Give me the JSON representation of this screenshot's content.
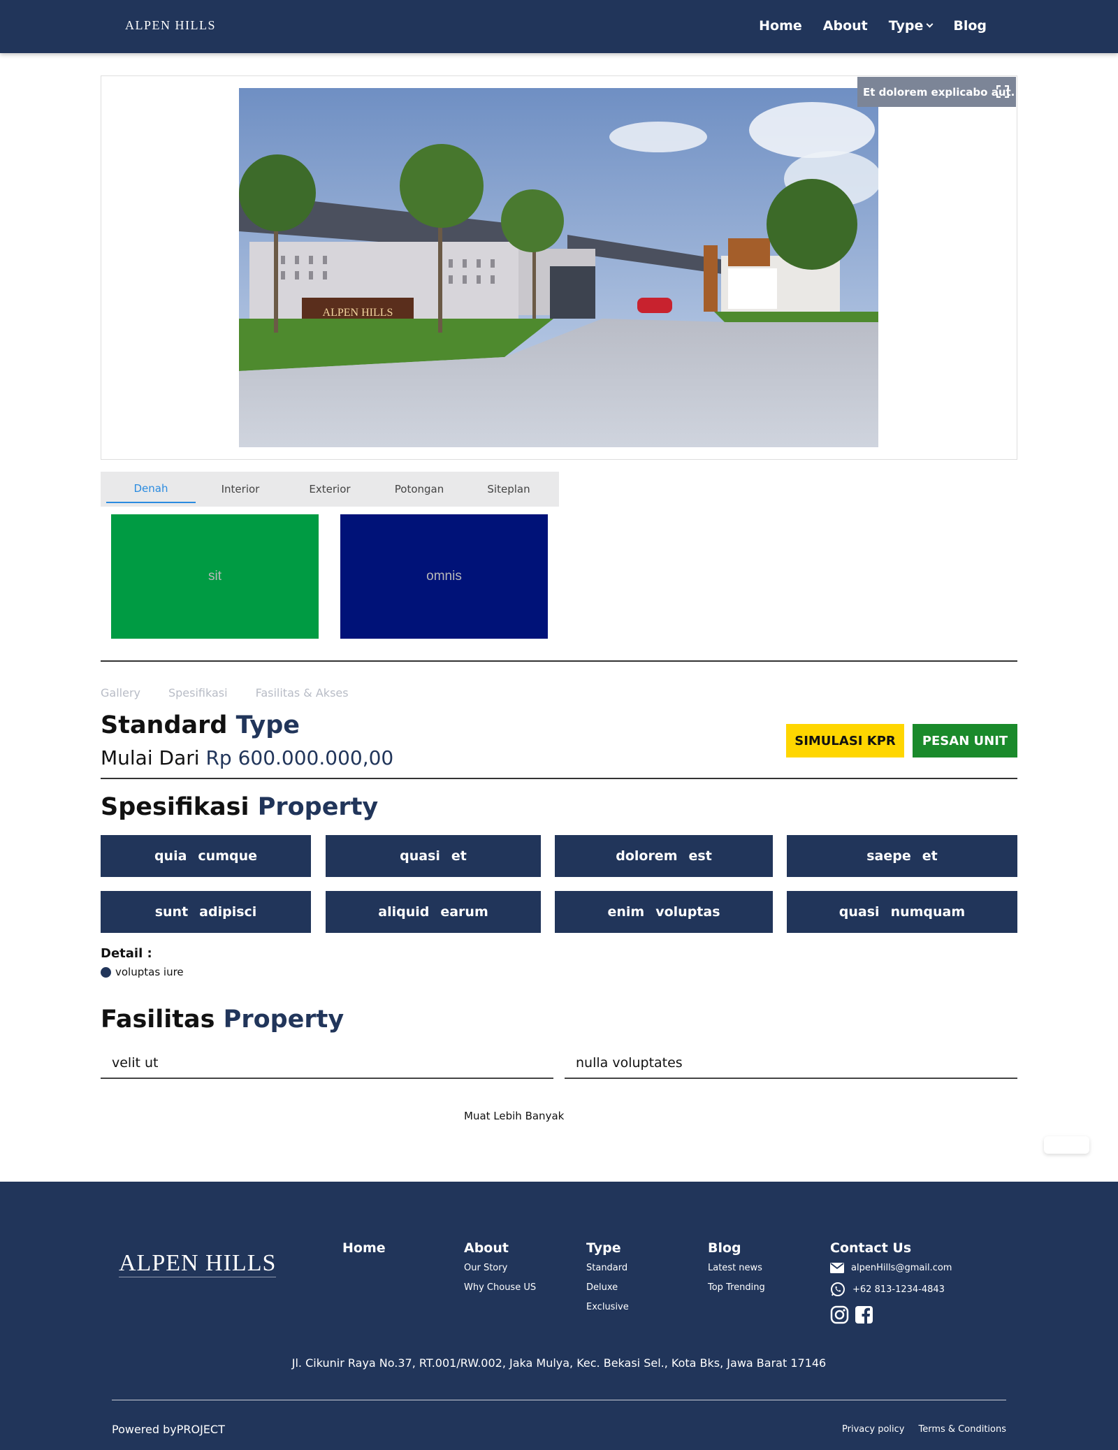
{
  "nav": {
    "logo": "ALPEN HILLS",
    "links": [
      "Home",
      "About",
      "Type",
      "Blog"
    ]
  },
  "hero": {
    "caption": "Et dolorem explicabo aut.",
    "image_sign": "ALPEN HILLS"
  },
  "gallery": {
    "tabs": [
      "Denah",
      "Interior",
      "Exterior",
      "Potongan",
      "Siteplan"
    ],
    "active_tab": "Denah",
    "thumbs": [
      {
        "label": "sit",
        "color": "#009b43"
      },
      {
        "label": "omnis",
        "color": "#001278"
      }
    ]
  },
  "section_nav": [
    "Gallery",
    "Spesifikasi",
    "Fasilitas & Akses"
  ],
  "type_header": {
    "title_main": "Standard",
    "title_accent": "Type",
    "price_prefix": "Mulai Dari",
    "price_value": "Rp 600.000.000,00",
    "btn_kpr": "SIMULASI KPR",
    "btn_pesan": "PESAN UNIT"
  },
  "spesifikasi": {
    "title_main": "Spesifikasi",
    "title_accent": "Property",
    "items": [
      {
        "a": "quia",
        "b": "cumque"
      },
      {
        "a": "quasi",
        "b": "et"
      },
      {
        "a": "dolorem",
        "b": "est"
      },
      {
        "a": "saepe",
        "b": "et"
      },
      {
        "a": "sunt",
        "b": "adipisci"
      },
      {
        "a": "aliquid",
        "b": "earum"
      },
      {
        "a": "enim",
        "b": "voluptas"
      },
      {
        "a": "quasi",
        "b": "numquam"
      }
    ],
    "detail_label": "Detail :",
    "detail_items": [
      "voluptas iure"
    ]
  },
  "fasilitas": {
    "title_main": "Fasilitas",
    "title_accent": "Property",
    "items": [
      "velit ut",
      "nulla voluptates"
    ],
    "load_more": "Muat Lebih Banyak"
  },
  "footer": {
    "logo": "ALPEN HILLS",
    "home": "Home",
    "about": {
      "title": "About",
      "links": [
        "Our Story",
        "Why Chouse US"
      ]
    },
    "type": {
      "title": "Type",
      "links": [
        "Standard",
        "Deluxe",
        "Exclusive"
      ]
    },
    "blog": {
      "title": "Blog",
      "links": [
        "Latest news",
        "Top Trending"
      ]
    },
    "contact": {
      "title": "Contact Us",
      "email": "alpenHills@gmail.com",
      "phone": "+62 813-1234-4843"
    },
    "address": "Jl. Cikunir Raya No.37, RT.001/RW.002, Jaka Mulya, Kec. Bekasi Sel., Kota Bks, Jawa Barat 17146",
    "powered": "Powered byPROJECT",
    "legal": [
      "Privacy policy",
      "Terms & Conditions"
    ]
  },
  "colors": {
    "primary": "#21355a",
    "kpr": "#ffd600",
    "pesan": "#1a8a2b",
    "tab_active": "#2a8be0"
  }
}
